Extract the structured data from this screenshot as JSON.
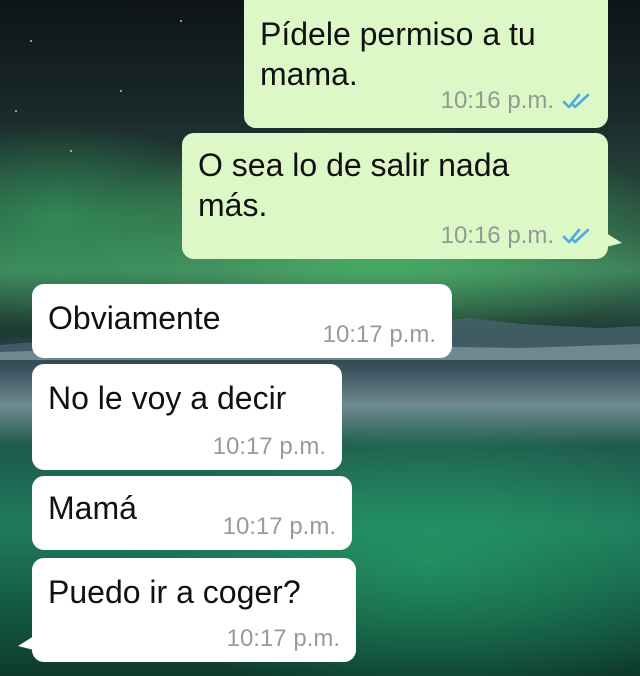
{
  "messages": [
    {
      "direction": "outgoing",
      "text": "Pídele permiso a tu mama.",
      "time": "10:16 p.m.",
      "status": "read"
    },
    {
      "direction": "outgoing",
      "text": "O sea lo de salir nada más.",
      "time": "10:16 p.m.",
      "status": "read"
    },
    {
      "direction": "incoming",
      "text": "Obviamente",
      "time": "10:17 p.m."
    },
    {
      "direction": "incoming",
      "text": "No le voy a decir",
      "time": "10:17 p.m."
    },
    {
      "direction": "incoming",
      "text": "Mamá",
      "time": "10:17 p.m."
    },
    {
      "direction": "incoming",
      "text": "Puedo ir a coger?",
      "time": "10:17 p.m."
    }
  ],
  "colors": {
    "outgoing_bubble": "#dcf8c6",
    "incoming_bubble": "#ffffff",
    "read_tick": "#4fa9e3",
    "timestamp": "#8f9b93"
  },
  "icons": {
    "read_receipt": "double-check-icon"
  }
}
